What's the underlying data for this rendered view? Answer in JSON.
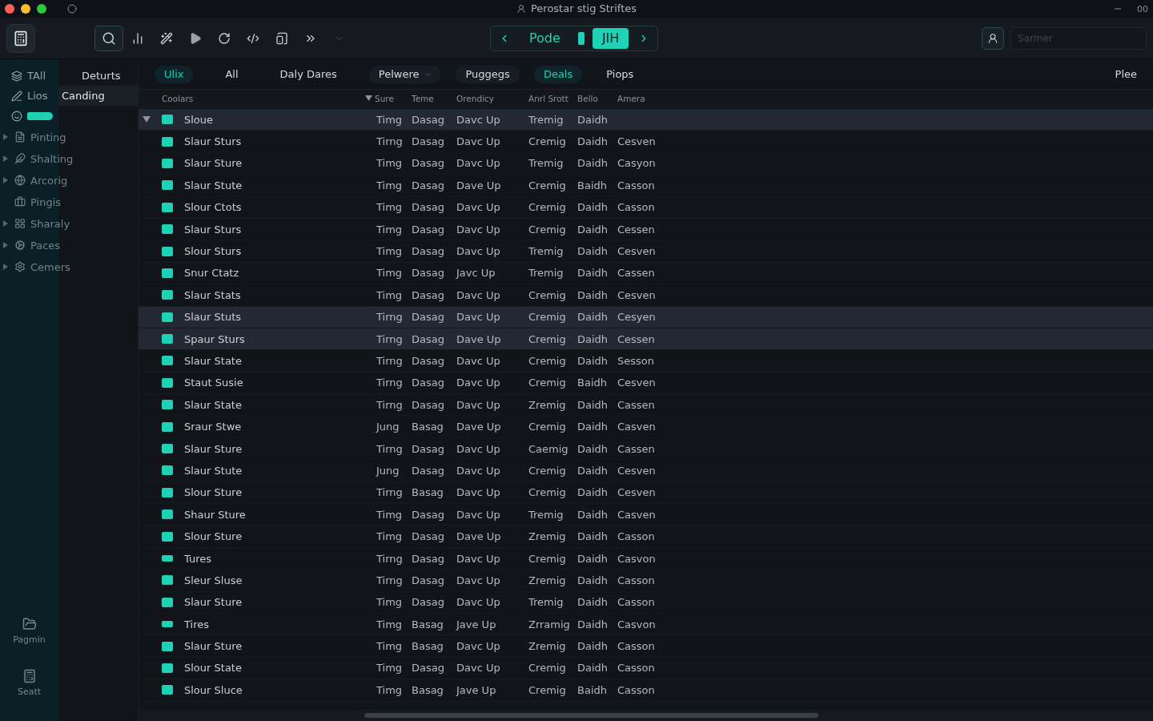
{
  "window": {
    "title": "Perostar stig Striftes",
    "corner_text": "00"
  },
  "toolbar": {
    "search_placeholder": "Sarmer",
    "nav": [
      {
        "label": "Pode",
        "selected": false
      },
      {
        "label": "JIH",
        "selected": true
      }
    ]
  },
  "sidebar": {
    "header": "Deturts",
    "items": [
      {
        "kind": "pair",
        "label": "TAll"
      },
      {
        "kind": "pair",
        "label": "Lios",
        "side_label": "Canding",
        "selected": true
      },
      {
        "kind": "pill"
      },
      {
        "kind": "group",
        "label": "Pinting"
      },
      {
        "kind": "group",
        "label": "Shalting"
      },
      {
        "kind": "group",
        "label": "Arcorig"
      },
      {
        "kind": "item",
        "label": "Pingis"
      },
      {
        "kind": "group",
        "label": "Sharaly"
      },
      {
        "kind": "group",
        "label": "Paces"
      },
      {
        "kind": "group",
        "label": "Cemers"
      }
    ],
    "bottom": [
      {
        "label": "Pagmin"
      },
      {
        "label": "Seatt"
      }
    ]
  },
  "tabs": [
    {
      "label": "Ulix",
      "selected": true,
      "kind": "plain"
    },
    {
      "label": "All",
      "selected": false,
      "kind": "plain"
    },
    {
      "label": "Daly Dares",
      "selected": false,
      "kind": "plain"
    },
    {
      "label": "Pelwere",
      "selected": false,
      "kind": "dropdown"
    },
    {
      "label": "Puggegs",
      "selected": false,
      "kind": "pill"
    },
    {
      "label": "Deals",
      "selected": true,
      "kind": "pill"
    },
    {
      "label": "Piops",
      "selected": false,
      "kind": "plain"
    }
  ],
  "tabs_right": "Plee",
  "table": {
    "columns": [
      "Coolars",
      "Sure",
      "Teme",
      "Orendicy",
      "Anrl Srott",
      "Bello",
      "Amera"
    ],
    "rows": [
      {
        "kind": "item",
        "cells": [
          "Sloue",
          "Timg",
          "Dasag",
          "Davc Up",
          "Tremig",
          "Daidh"
        ],
        "expanded": true,
        "selected": true
      },
      {
        "kind": "item",
        "cells": [
          "Slaur Sturs",
          "Tirng",
          "Dasag",
          "Davc Up",
          "Cremig",
          "Daidh",
          "Cesven"
        ],
        "selected": false
      },
      {
        "kind": "item",
        "cells": [
          "Slaur Sture",
          "Timg",
          "Dasag",
          "Davc Up",
          "Tremig",
          "Daidh",
          "Casyon"
        ],
        "selected": false
      },
      {
        "kind": "item",
        "cells": [
          "Slaur Stute",
          "Timg",
          "Dasag",
          "Dave Up",
          "Cremig",
          "Baidh",
          "Casson"
        ],
        "selected": false
      },
      {
        "kind": "item",
        "cells": [
          "Slour Ctots",
          "Timg",
          "Dasag",
          "Davc Up",
          "Cremig",
          "Daidh",
          "Casson"
        ],
        "selected": false
      },
      {
        "kind": "item",
        "cells": [
          "Slaur Sturs",
          "Timg",
          "Dasag",
          "Davc Up",
          "Cremig",
          "Daidh",
          "Cessen"
        ],
        "selected": false
      },
      {
        "kind": "item",
        "cells": [
          "Slour Sturs",
          "Timg",
          "Dasag",
          "Davc Up",
          "Tremig",
          "Daidh",
          "Cesven"
        ],
        "selected": false
      },
      {
        "kind": "item",
        "cells": [
          "Snur Ctatz",
          "Timg",
          "Dasag",
          "Javc Up",
          "Tremig",
          "Daidh",
          "Cassen"
        ],
        "selected": false
      },
      {
        "kind": "item",
        "cells": [
          "Slaur Stats",
          "Timg",
          "Dasag",
          "Davc Up",
          "Cremig",
          "Daidh",
          "Cesven"
        ],
        "selected": false
      },
      {
        "kind": "item",
        "cells": [
          "Slaur Stuts",
          "Tirng",
          "Dasag",
          "Davc Up",
          "Cremig",
          "Daidh",
          "Cesyen"
        ],
        "selected": true
      },
      {
        "kind": "item",
        "cells": [
          "Spaur Sturs",
          "Tirng",
          "Dasag",
          "Dave Up",
          "Cremig",
          "Daidh",
          "Cessen"
        ],
        "selected": true
      },
      {
        "kind": "item",
        "cells": [
          "Slaur State",
          "Tirng",
          "Dasag",
          "Davc Up",
          "Cremig",
          "Daidh",
          "Sesson"
        ],
        "selected": false
      },
      {
        "kind": "item",
        "cells": [
          "Staut Susie",
          "Tirng",
          "Dasag",
          "Davc Up",
          "Cremig",
          "Baidh",
          "Cesven"
        ],
        "selected": false
      },
      {
        "kind": "item",
        "cells": [
          "Slaur State",
          "Tirng",
          "Dasag",
          "Davc Up",
          "Zremig",
          "Daidh",
          "Cassen"
        ],
        "selected": false
      },
      {
        "kind": "item",
        "cells": [
          "Sraur Stwe",
          "Jung",
          "Basag",
          "Dave Up",
          "Cremig",
          "Daidh",
          "Casven"
        ],
        "selected": false
      },
      {
        "kind": "item",
        "cells": [
          "Slaur Sture",
          "Tirng",
          "Dasag",
          "Davc Up",
          "Caemig",
          "Daidh",
          "Cassen"
        ],
        "selected": false
      },
      {
        "kind": "item",
        "cells": [
          "Slaur Stute",
          "Jung",
          "Dasag",
          "Davc Up",
          "Cremig",
          "Daidh",
          "Cesven"
        ],
        "selected": false
      },
      {
        "kind": "item",
        "cells": [
          "Slour Sture",
          "Tirng",
          "Basag",
          "Davc Up",
          "Cremig",
          "Daidh",
          "Cesven"
        ],
        "selected": false
      },
      {
        "kind": "item",
        "cells": [
          "Shaur Sture",
          "Timg",
          "Dasag",
          "Davc Up",
          "Tremig",
          "Daidh",
          "Casven"
        ],
        "selected": false
      },
      {
        "kind": "item",
        "cells": [
          "Slour Sture",
          "Timg",
          "Dasag",
          "Dave Up",
          "Zremig",
          "Daidh",
          "Casson"
        ],
        "selected": false
      },
      {
        "kind": "flat",
        "cells": [
          "Tures",
          "Tirng",
          "Dasag",
          "Davc Up",
          "Cremig",
          "Daidh",
          "Casvon"
        ],
        "selected": false
      },
      {
        "kind": "item",
        "cells": [
          "Sleur Sluse",
          "Tirng",
          "Dasag",
          "Davc Up",
          "Zremig",
          "Daidh",
          "Casson"
        ],
        "selected": false
      },
      {
        "kind": "item",
        "cells": [
          "Slaur Sture",
          "Timg",
          "Dasag",
          "Davc Up",
          "Tremig",
          "Daidh",
          "Casson"
        ],
        "selected": false
      },
      {
        "kind": "flat",
        "cells": [
          "Tires",
          "Timg",
          "Basag",
          "Jave Up",
          "Zrramig",
          "Daidh",
          "Casvon"
        ],
        "selected": false
      },
      {
        "kind": "item",
        "cells": [
          "Slaur Sture",
          "Timg",
          "Basag",
          "Davc Up",
          "Zremig",
          "Daidh",
          "Casson"
        ],
        "selected": false
      },
      {
        "kind": "item",
        "cells": [
          "Slour State",
          "Timg",
          "Dasag",
          "Davc Up",
          "Cremig",
          "Daidh",
          "Casson"
        ],
        "selected": false
      },
      {
        "kind": "item",
        "cells": [
          "Slour Sluce",
          "Timg",
          "Basag",
          "Jave Up",
          "Cremig",
          "Baidh",
          "Casson"
        ],
        "selected": false
      }
    ]
  }
}
